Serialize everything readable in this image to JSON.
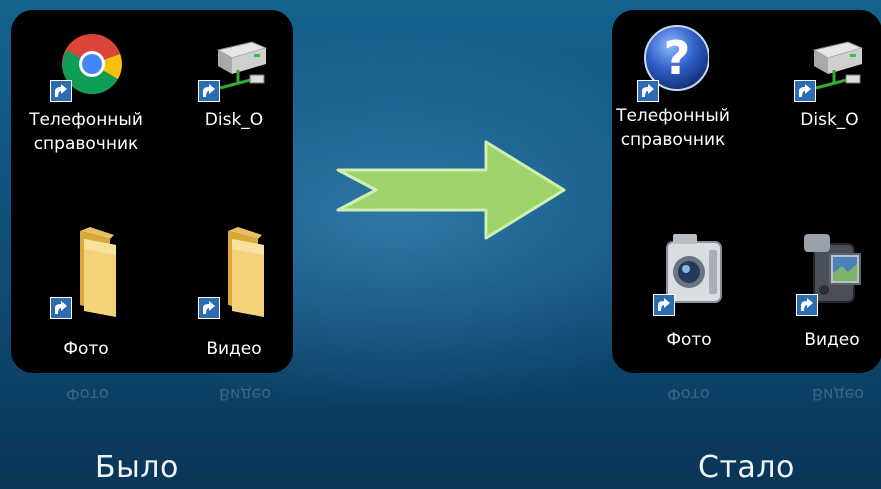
{
  "before": {
    "caption": "Было",
    "shortcuts": [
      {
        "label_line1": "Телефонный",
        "label_line2": "справочник",
        "icon": "chrome-icon"
      },
      {
        "label_line1": "Disk_O",
        "icon": "network-drive-icon"
      },
      {
        "label_line1": "Фото",
        "icon": "folder-icon"
      },
      {
        "label_line1": "Видео",
        "icon": "folder-icon"
      }
    ],
    "reflection": {
      "left": "Фото",
      "right": "Видео"
    }
  },
  "after": {
    "caption": "Стало",
    "shortcuts": [
      {
        "label_line1": "Телефонный",
        "label_line2": "справочник",
        "icon": "help-icon"
      },
      {
        "label_line1": "Disk_O",
        "icon": "network-drive-icon"
      },
      {
        "label_line1": "Фото",
        "icon": "camera-icon"
      },
      {
        "label_line1": "Видео",
        "icon": "video-camera-icon"
      }
    ],
    "reflection": {
      "left": "Фото",
      "right": "Видео"
    }
  },
  "colors": {
    "arrow_fill": "#9ed26b",
    "arrow_stroke": "#cfeeb0",
    "panel_bg": "#000000",
    "background": "#11547f"
  }
}
